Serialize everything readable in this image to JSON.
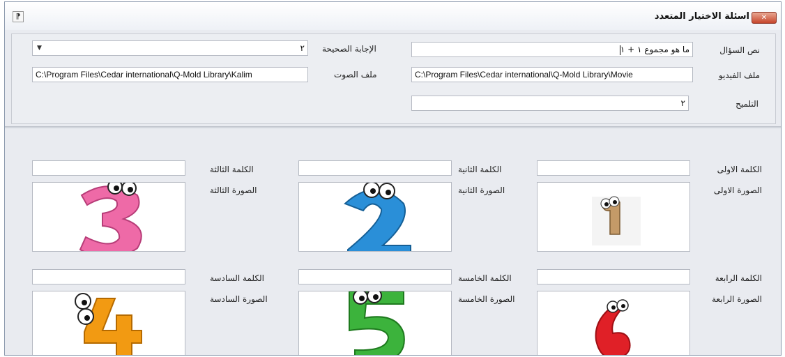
{
  "window": {
    "title": "اسئلة الاختيار المتعدد",
    "close_glyph": "✕",
    "system_icon_glyph": "⁋"
  },
  "question": {
    "text_label": "نص السؤال",
    "text_value": "ما هو مجموع ١ + ١",
    "correct_label": "الإجابة الصحيحة",
    "correct_value": "٢",
    "video_label": "ملف الفيديو",
    "video_value": "C:\\Program Files\\Cedar international\\Q-Mold Library\\Movie",
    "audio_label": "ملف الصوت",
    "audio_value": "C:\\Program Files\\Cedar international\\Q-Mold Library\\Kalim",
    "hint_label": "التلميح",
    "hint_value": "٢"
  },
  "choices": [
    {
      "word_label": "الكلمة الاولى",
      "word_value": "",
      "image_label": "الصورة الاولى",
      "digit": "1",
      "color": "#c49a68"
    },
    {
      "word_label": "الكلمة الثانية",
      "word_value": "",
      "image_label": "الصورة الثانية",
      "digit": "2",
      "color": "#2a8fd8"
    },
    {
      "word_label": "الكلمة الثالثة",
      "word_value": "",
      "image_label": "الصورة الثالثة",
      "digit": "3",
      "color": "#ee6aa7"
    },
    {
      "word_label": "الكلمة الرابعة",
      "word_value": "",
      "image_label": "الصورة الرابعة",
      "digit": "6",
      "color": "#e02027"
    },
    {
      "word_label": "الكلمة الخامسة",
      "word_value": "",
      "image_label": "الصورة الخامسة",
      "digit": "5",
      "color": "#3cb33c"
    },
    {
      "word_label": "الكلمة السادسة",
      "word_value": "",
      "image_label": "الصورة السادسة",
      "digit": "4",
      "color": "#f29a12"
    }
  ]
}
